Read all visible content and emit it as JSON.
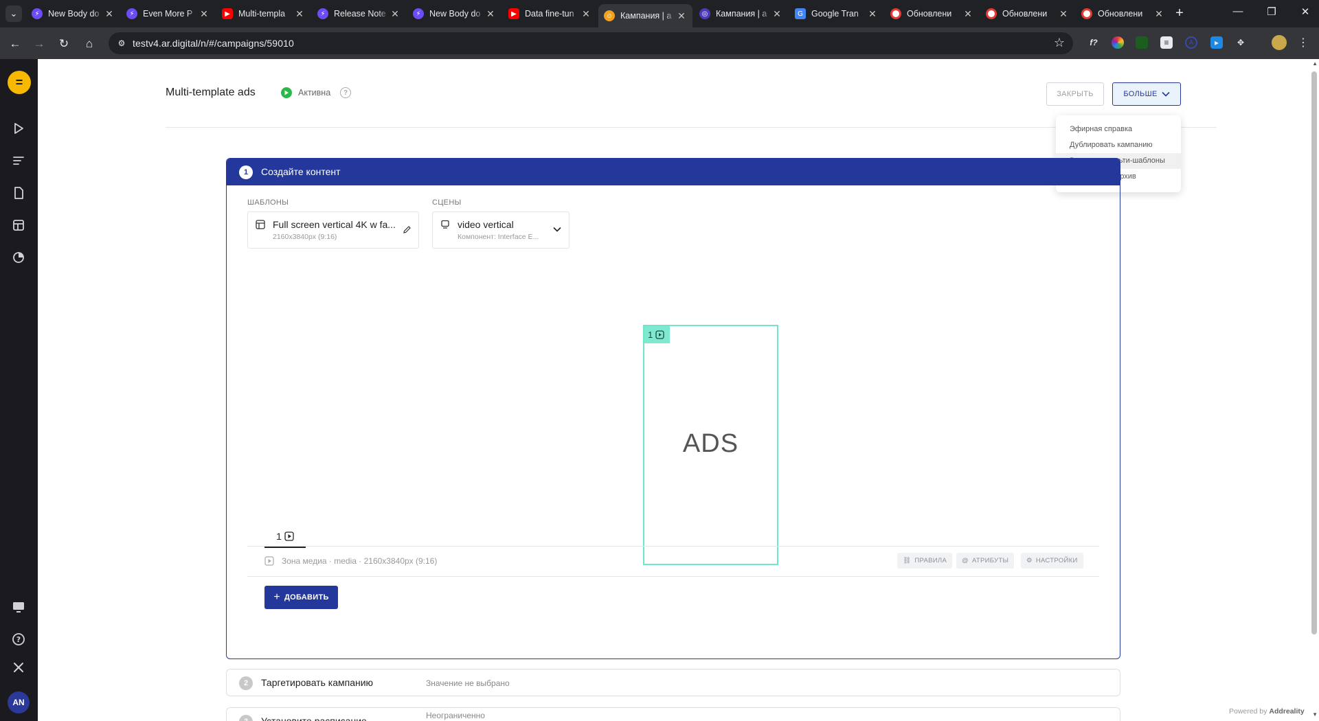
{
  "browser": {
    "tabs": [
      {
        "title": "New Body do",
        "icon": "bolt-icon",
        "color": "#6c4cf5"
      },
      {
        "title": "Even More P",
        "icon": "bolt-icon",
        "color": "#6c4cf5"
      },
      {
        "title": "Multi-templa",
        "icon": "youtube-icon",
        "color": "#ff0000"
      },
      {
        "title": "Release Note",
        "icon": "bolt-icon",
        "color": "#6c4cf5"
      },
      {
        "title": "New Body do",
        "icon": "bolt-icon",
        "color": "#6c4cf5"
      },
      {
        "title": "Data fine-tun",
        "icon": "youtube-icon",
        "color": "#ff0000"
      },
      {
        "title": "Кампания | a",
        "icon": "face-icon",
        "color": "#f3a21c"
      },
      {
        "title": "Кампания | a",
        "icon": "circle-icon",
        "color": "#4b3bb8"
      },
      {
        "title": "Google Tran",
        "icon": "translate-icon",
        "color": "#4285f4"
      },
      {
        "title": "Обновлени",
        "icon": "lifebuoy-icon",
        "color": "#e53935"
      },
      {
        "title": "Обновлени",
        "icon": "lifebuoy-icon",
        "color": "#e53935"
      },
      {
        "title": "Обновлени",
        "icon": "lifebuoy-icon",
        "color": "#e53935"
      }
    ],
    "active_tab_index": 6,
    "url": "testv4.ar.digital/n/#/campaigns/59010",
    "ext_label": "f?"
  },
  "app": {
    "avatar_initials": "AN",
    "campaign_title": "Multi-template ads",
    "status_label": "Активна",
    "status_color": "#29b84a",
    "help_glyph": "?",
    "close_button": "ЗАКРЫТЬ",
    "more_button": "БОЛЬШЕ",
    "more_menu": [
      "Эфирная справка",
      "Дублировать кампанию",
      "Включить мульти-шаблоны",
      "Поместить в архив"
    ],
    "accent_color": "#23389a"
  },
  "step1": {
    "number": "1",
    "title": "Создайте контент",
    "templates_label": "ШАБЛОНЫ",
    "template_name": "Full screen vertical 4K w fa...",
    "template_size": "2160x3840px (9:16)",
    "scenes_label": "СЦЕНЫ",
    "scene_name": "video vertical",
    "scene_component": "Компонент: Interface E...",
    "canvas_zone_number": "1",
    "canvas_text": "ADS",
    "zone_tab_number": "1",
    "zone_info": "Зона медиа · media · 2160x3840px (9:16)",
    "chip_rules": "ПРАВИЛА",
    "chip_attributes": "АТРИБУТЫ",
    "chip_settings": "НАСТРОЙКИ",
    "add_button": "ДОБАВИТЬ"
  },
  "step2": {
    "number": "2",
    "title": "Таргетировать кампанию",
    "value": "Значение не выбрано"
  },
  "step3": {
    "number": "3",
    "title": "Установите расписание",
    "value": "Неограниченно"
  },
  "footer": {
    "powered_by": "Powered by",
    "brand": "Addreality"
  }
}
